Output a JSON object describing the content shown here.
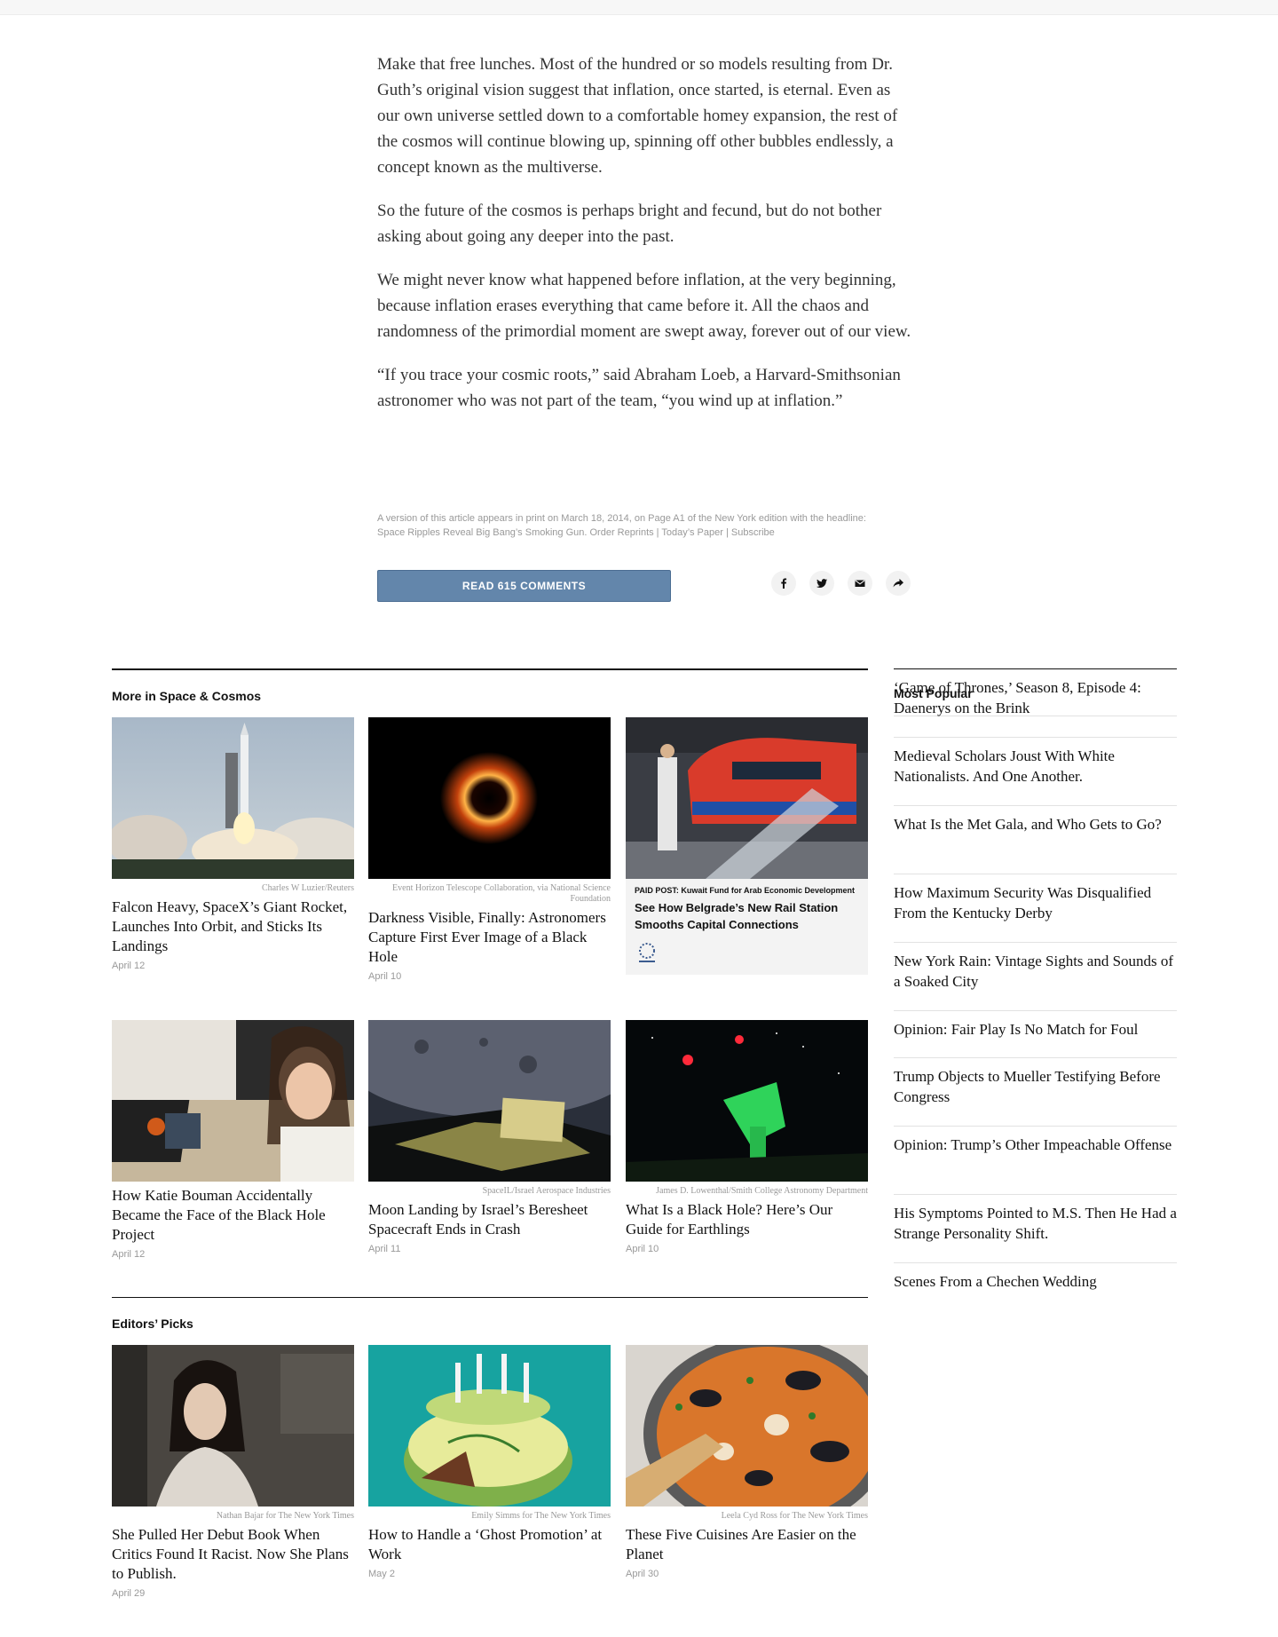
{
  "article": {
    "paragraphs": [
      "Make that free lunches. Most of the hundred or so models resulting from Dr. Guth’s original vision suggest that inflation, once started, is eternal. Even as our own universe settled down to a comfortable homey expansion, the rest of the cosmos will continue blowing up, spinning off other bubbles endlessly, a concept known as the multiverse.",
      "So the future of the cosmos is perhaps bright and fecund, but do not bother asking about going any deeper into the past.",
      "We might never know what happened before inflation, at the very beginning, because inflation erases everything that came before it. All the chaos and randomness of the primordial moment are swept away, forever out of our view.",
      "“If you trace your cosmic roots,” said Abraham Loeb, a Harvard-Smithsonian astronomer who was not part of the team, “you wind up at inflation.”"
    ],
    "print_line_1": "A version of this article appears in print on March 18, 2014, on Page A1 of the New York edition with the headline:",
    "print_line_2": "Space Ripples Reveal Big Bang’s Smoking Gun. Order Reprints | Today’s Paper | Subscribe",
    "comments_button": "READ 615 COMMENTS"
  },
  "share": [
    "facebook-icon",
    "twitter-icon",
    "email-icon",
    "share-icon"
  ],
  "more_in_space": {
    "title": "More in Space & Cosmos",
    "cards": [
      {
        "credit": "Charles W Luzier/Reuters",
        "headline": "Falcon Heavy, SpaceX’s Giant Rocket, Launches Into Orbit, and Sticks Its Landings",
        "date": "April 12"
      },
      {
        "credit": "Event Horizon Telescope Collaboration, via National Science Foundation",
        "headline": "Darkness Visible, Finally: Astronomers Capture First Ever Image of a Black Hole",
        "date": "April 10"
      },
      {
        "credit": "",
        "headline": "How Katie Bouman Accidentally Became the Face of the Black Hole Project",
        "date": "April 12"
      },
      {
        "credit": "SpaceIL/Israel Aerospace Industries",
        "headline": "Moon Landing by Israel’s Beresheet Spacecraft Ends in Crash",
        "date": "April 11"
      },
      {
        "credit": "James D. Lowenthal/Smith College Astronomy Department",
        "headline": "What Is a Black Hole? Here’s Our Guide for Earthlings",
        "date": "April 10"
      }
    ],
    "paid_post": {
      "label": "PAID POST: Kuwait Fund for Arab Economic Development",
      "headline": "See How Belgrade’s New Rail Station Smooths Capital Connections"
    }
  },
  "editors_picks": {
    "title": "Editors’ Picks",
    "cards": [
      {
        "credit": "Nathan Bajar for The New York Times",
        "headline": "She Pulled Her Debut Book When Critics Found It Racist. Now She Plans to Publish.",
        "date": "April 29"
      },
      {
        "credit": "Emily Simms for The New York Times",
        "headline": "How to Handle a ‘Ghost Promotion’ at Work",
        "date": "May 2"
      },
      {
        "credit": "Leela Cyd Ross for The New York Times",
        "headline": "These Five Cuisines Are Easier on the Planet",
        "date": "April 30"
      }
    ]
  },
  "most_popular": {
    "title": "Most Popular",
    "items": [
      "‘Game of Thrones,’ Season 8, Episode 4: Daenerys on the Brink",
      "Medieval Scholars Joust With White Nationalists. And One Another.",
      "What Is the Met Gala, and Who Gets to Go?",
      "How Maximum Security Was Disqualified From the Kentucky Derby",
      "New York Rain: Vintage Sights and Sounds of a Soaked City",
      "Opinion: Fair Play Is No Match for Foul",
      "Trump Objects to Mueller Testifying Before Congress",
      "Opinion: Trump’s Other Impeachable Offense",
      "His Symptoms Pointed to M.S. Then He Had a Strange Personality Shift.",
      "Scenes From a Chechen Wedding"
    ]
  },
  "colors": {
    "comments_button": "#6386ab",
    "rule": "#121212",
    "muted": "#999999"
  }
}
